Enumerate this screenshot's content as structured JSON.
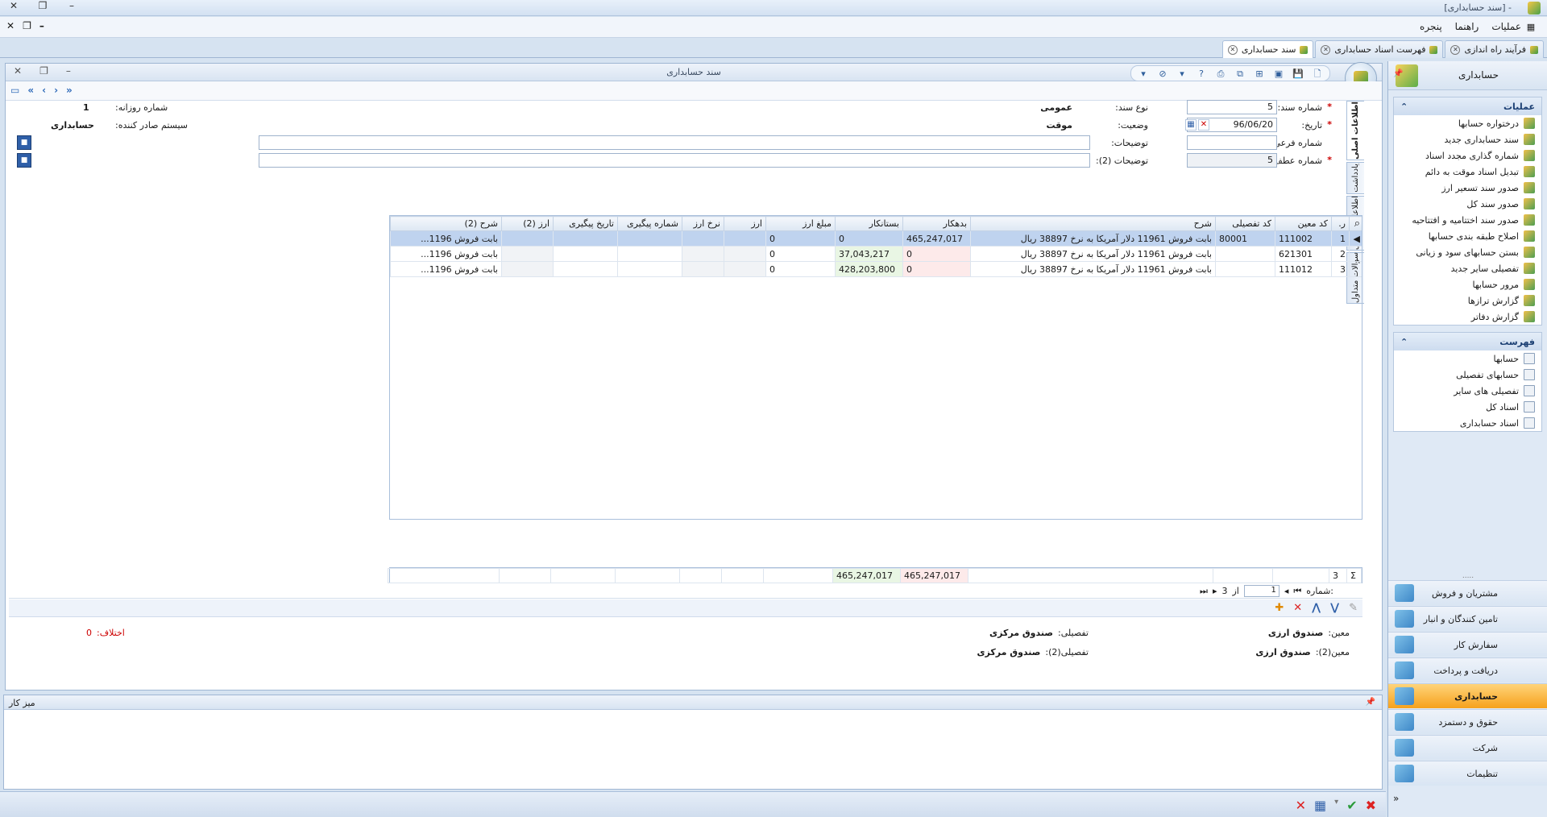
{
  "window": {
    "title": "[سند حسابداری] -"
  },
  "menu": {
    "items": [
      "عملیات",
      "راهنما",
      "پنجره"
    ]
  },
  "doc_tabs": [
    {
      "label": "فرآیند راه اندازی",
      "active": false
    },
    {
      "label": "فهرست اسناد حسابداری",
      "active": false
    },
    {
      "label": "سند حسابداری",
      "active": true
    }
  ],
  "nav": {
    "title": "حسابداری",
    "groups": [
      {
        "title": "عملیات",
        "items": [
          "درختواره حسابها",
          "سند حسابداری جدید",
          "شماره گذاری مجدد اسناد",
          "تبدیل اسناد موقت به دائم",
          "صدور سند تسعیر ارز",
          "صدور سند کل",
          "صدور سند اختتامیه و افتتاحیه",
          "اصلاح طبقه بندی حسابها",
          "بستن حسابهای سود و زیانی",
          "تفصیلی سایر جدید",
          "مرور حسابها",
          "گزارش ترازها",
          "گزارش دفاتر"
        ]
      },
      {
        "title": "فهرست",
        "items": [
          "حسابها",
          "حسابهای تفصیلی",
          "تفصیلی های سایر",
          "اسناد کل",
          "اسناد حسابداری"
        ]
      }
    ],
    "modules": [
      {
        "label": "مشتریان و فروش",
        "active": false
      },
      {
        "label": "تامین کنندگان و انبار",
        "active": false
      },
      {
        "label": "سفارش کار",
        "active": false
      },
      {
        "label": "دریافت و پرداخت",
        "active": false
      },
      {
        "label": "حسابداری",
        "active": true
      },
      {
        "label": "حقوق و دستمزد",
        "active": false
      },
      {
        "label": "شرکت",
        "active": false
      },
      {
        "label": "تنظیمات",
        "active": false
      }
    ],
    "sep_dots": "....."
  },
  "form": {
    "title": "سند حسابداری",
    "fields": {
      "doc_no_label": "شماره سند:",
      "doc_no": "5",
      "date_label": "تاریخ:",
      "date": "96/06/20",
      "sub_no_label": "شماره فرعی:",
      "sub_no": "",
      "ref_no_label": "شماره عطف:",
      "ref_no": "5",
      "doc_type_label": "نوع سند:",
      "doc_type": "عمومی",
      "status_label": "وضعیت:",
      "status": "موقت",
      "daily_no_label": "شماره روزانه:",
      "daily_no": "1",
      "issuer_label": "سیستم صادر کننده:",
      "issuer": "حسابداری",
      "desc_label": "توضیحات:",
      "desc2_label": "توضیحات (2):",
      "req_mark": "*"
    },
    "side_tabs": [
      "اطلاعات اصلی",
      "یادداشت",
      "اطلاعات تکمیلی",
      "سوالات متداول"
    ]
  },
  "grid": {
    "columns": [
      "ر.",
      "کد معین",
      "کد تفصیلی",
      "شرح",
      "بدهکار",
      "بستانکار",
      "مبلغ ارز",
      "ارز",
      "نرخ ارز",
      "شماره پیگیری",
      "تاریخ پیگیری",
      "ارز (2)",
      "شرح (2)"
    ],
    "rows": [
      {
        "no": "1",
        "moein": "111002",
        "tafsili": "80001",
        "desc": "بابت فروش 11961 دلار آمریکا به نرخ 38897 ریال",
        "debit": "465,247,017",
        "credit": "0",
        "fx_amount": "0",
        "fx": "",
        "fx_rate": "",
        "track_no": "",
        "track_date": "",
        "fx2": "",
        "desc2": "بابت فروش 1196..."
      },
      {
        "no": "2",
        "moein": "621301",
        "tafsili": "",
        "desc": "بابت فروش 11961 دلار آمریکا به نرخ 38897 ریال",
        "debit": "0",
        "credit": "37,043,217",
        "fx_amount": "0",
        "fx": "",
        "fx_rate": "",
        "track_no": "",
        "track_date": "",
        "fx2": "",
        "desc2": "بابت فروش 1196..."
      },
      {
        "no": "3",
        "moein": "111012",
        "tafsili": "",
        "desc": "بابت فروش 11961 دلار آمریکا به نرخ 38897 ریال",
        "debit": "0",
        "credit": "428,203,800",
        "fx_amount": "0",
        "fx": "",
        "fx_rate": "",
        "track_no": "",
        "track_date": "",
        "fx2": "",
        "desc2": "بابت فروش 1196..."
      }
    ],
    "totals": {
      "count": "3",
      "debit": "465,247,017",
      "credit": "465,247,017"
    }
  },
  "pager": {
    "label": ":شماره",
    "current": "1",
    "of": "از",
    "total": "3"
  },
  "info": {
    "moein_label": "معین:",
    "moein": "صندوق ارزی",
    "moein2_label": "معین(2):",
    "moein2": "صندوق ارزی",
    "tafsili_label": "تفصیلی:",
    "tafsili": "صندوق مرکزی",
    "tafsili2_label": "تفصیلی(2):",
    "tafsili2": "صندوق مرکزی",
    "diff_label": "اختلاف:",
    "diff": "0"
  },
  "desk": {
    "title": "میز کار"
  },
  "colors": {
    "accent": "#2f5fa8",
    "active_module": "#f6a11c",
    "selected_row": "#bfd3ef",
    "debit_cell": "#fdeaea",
    "credit_cell": "#e9f6e4"
  }
}
